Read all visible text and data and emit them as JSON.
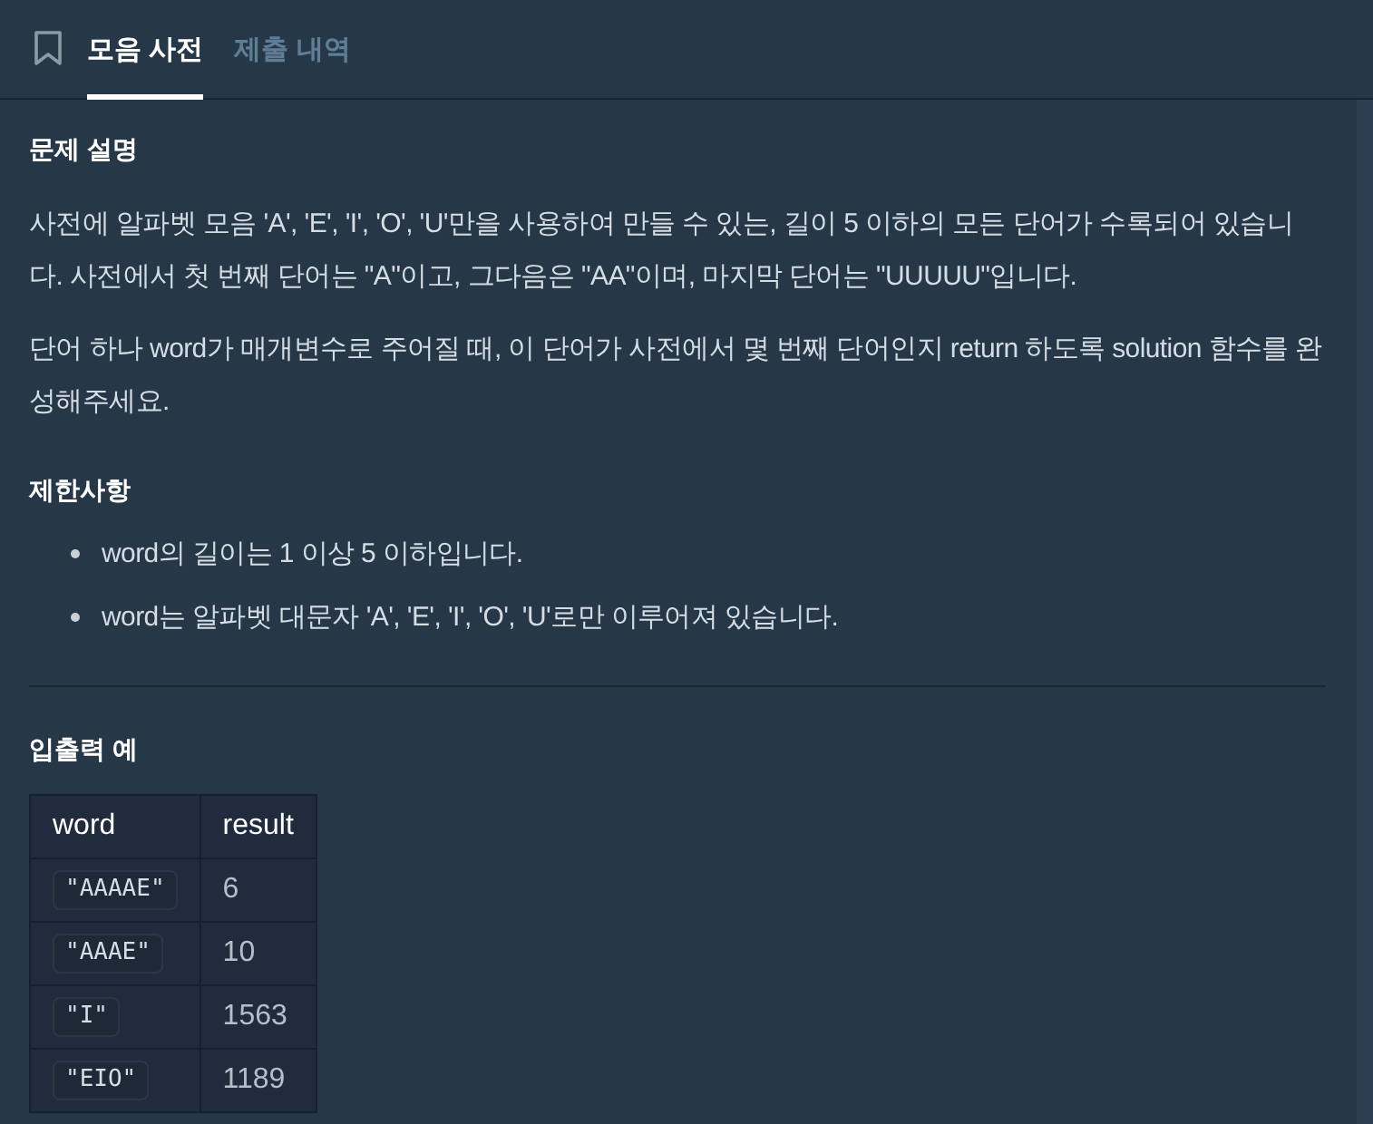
{
  "tabs": [
    {
      "label": "모음 사전",
      "selected": true
    },
    {
      "label": "제출 내역",
      "selected": false
    }
  ],
  "sections": [
    {
      "kind": "text",
      "heading": "문제 설명",
      "paragraphs": [
        "사전에 알파벳 모음 'A', 'E', 'I', 'O', 'U'만을 사용하여 만들 수 있는, 길이 5 이하의 모든 단어가 수록되어 있습니다. 사전에서 첫 번째 단어는 \"A\"이고, 그다음은 \"AA\"이며, 마지막 단어는 \"UUUUU\"입니다.",
        "단어 하나 word가 매개변수로 주어질 때, 이 단어가 사전에서 몇 번째 단어인지 return 하도록 solution 함수를 완성해주세요."
      ]
    },
    {
      "kind": "list",
      "heading": "제한사항",
      "items": [
        "word의 길이는 1 이상 5 이하입니다.",
        "word는 알파벳 대문자 'A', 'E', 'I', 'O', 'U'로만 이루어져 있습니다."
      ]
    },
    {
      "kind": "table",
      "heading": "입출력 예",
      "rule_above": true,
      "columns": [
        {
          "label": "word",
          "kind": "code"
        },
        {
          "label": "result",
          "kind": "text"
        }
      ],
      "rows": [
        [
          "\"AAAAE\"",
          "6"
        ],
        [
          "\"AAAE\"",
          "10"
        ],
        [
          "\"I\"",
          "1563"
        ],
        [
          "\"EIO\"",
          "1189"
        ]
      ]
    }
  ]
}
